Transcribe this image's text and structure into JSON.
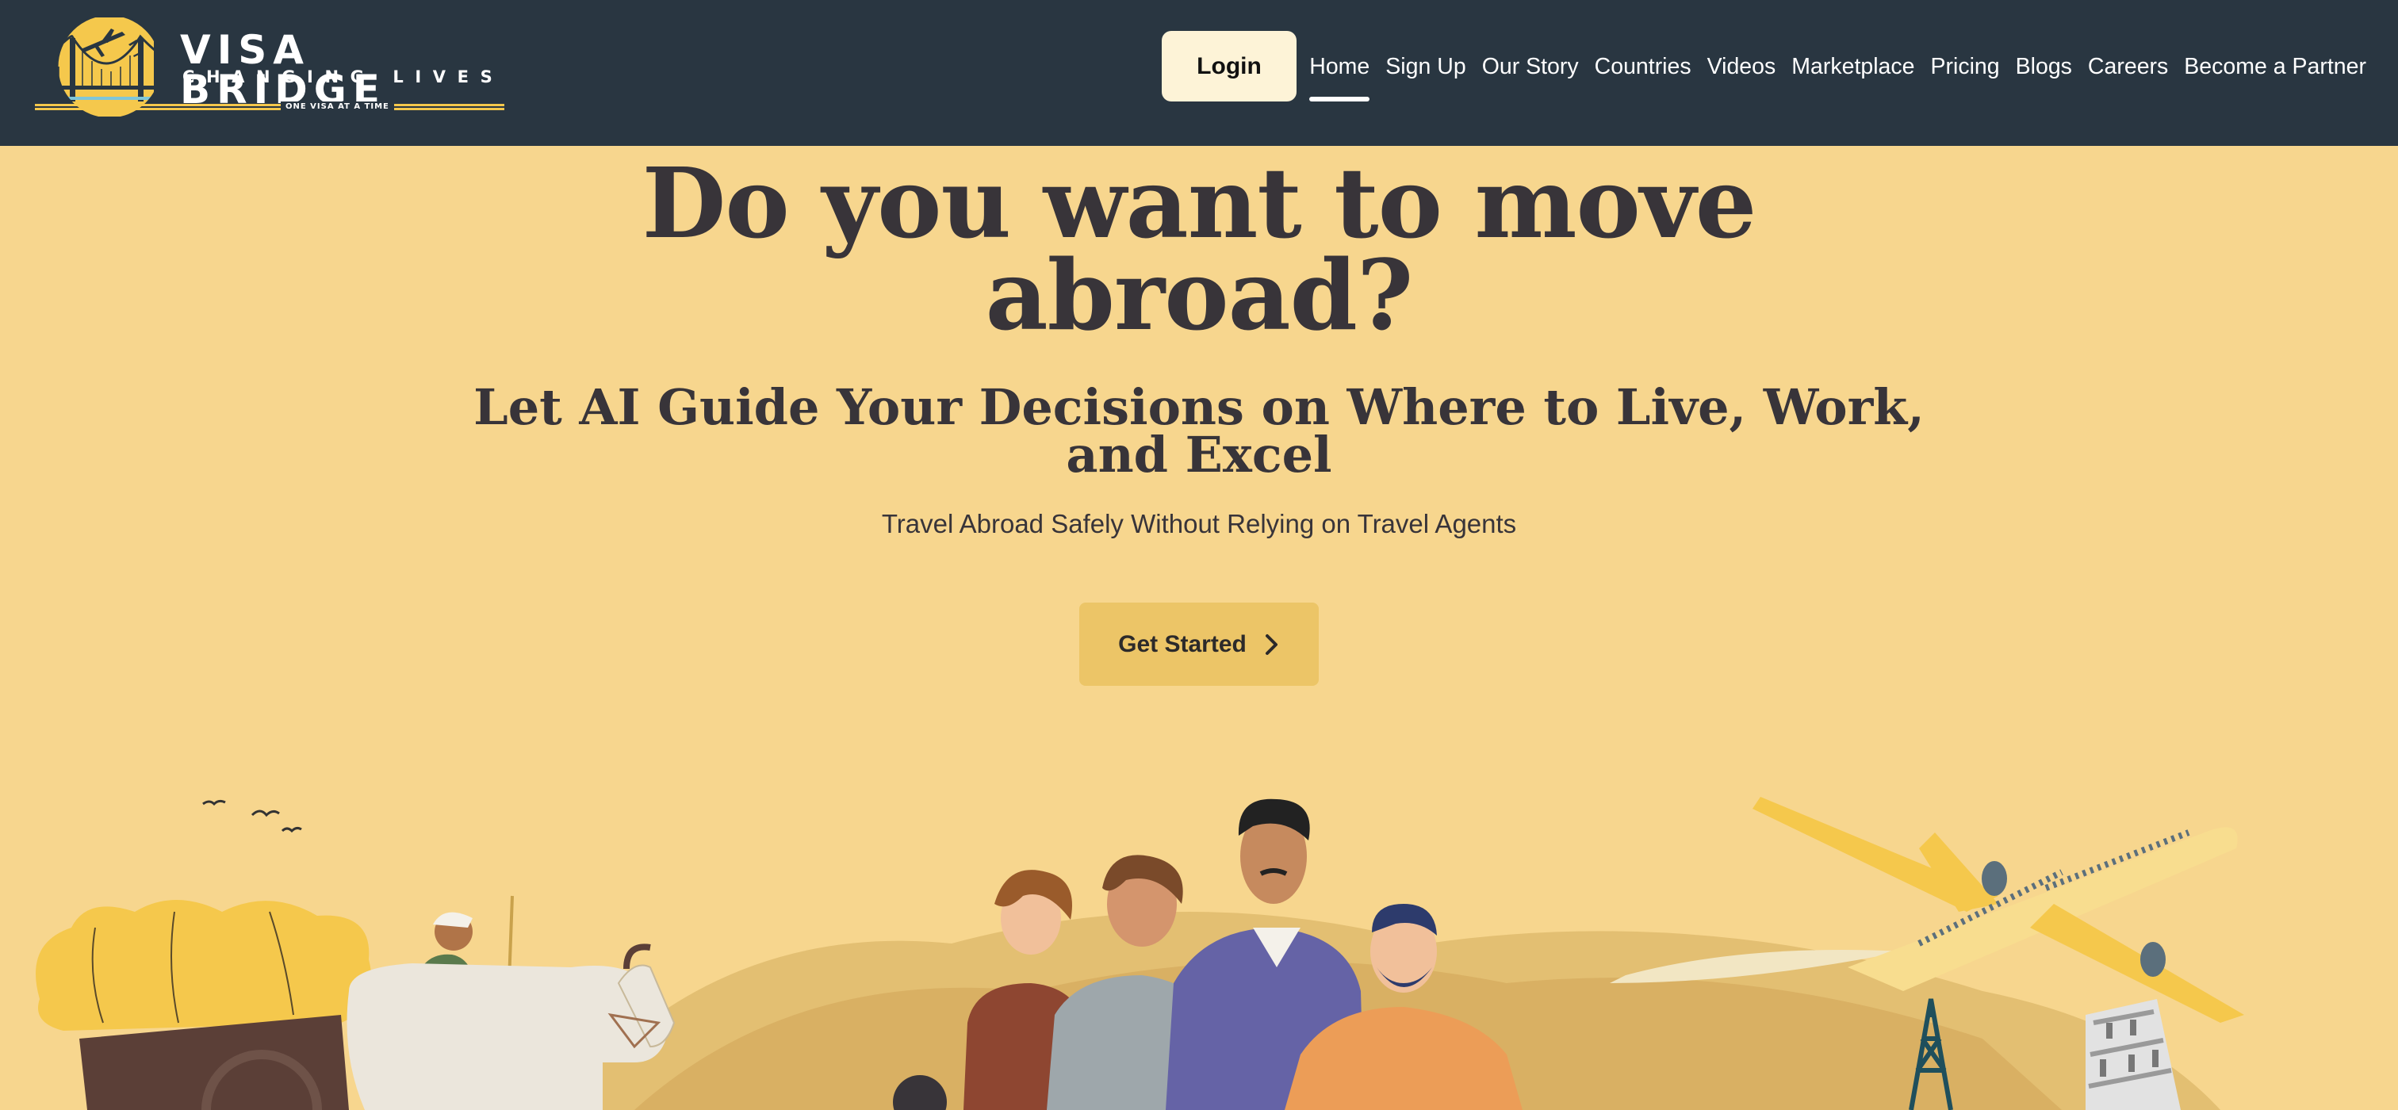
{
  "brand": {
    "name": "VISA BRIDGE",
    "subtitle": "CHANGING LIVES",
    "tagline": "ONE VISA AT A TIME"
  },
  "header": {
    "login_label": "Login",
    "nav": [
      {
        "label": "Home",
        "active": true
      },
      {
        "label": "Sign Up",
        "active": false
      },
      {
        "label": "Our Story",
        "active": false
      },
      {
        "label": "Countries",
        "active": false
      },
      {
        "label": "Videos",
        "active": false
      },
      {
        "label": "Marketplace",
        "active": false
      },
      {
        "label": "Pricing",
        "active": false
      },
      {
        "label": "Blogs",
        "active": false
      },
      {
        "label": "Careers",
        "active": false
      },
      {
        "label": "Become a Partner",
        "active": false
      }
    ]
  },
  "hero": {
    "title_line1": "Do you want to move",
    "title_line2": "abroad?",
    "subtitle": "Let AI Guide Your Decisions on Where to Live, Work, and Excel",
    "tagline": "Travel Abroad Safely Without Relying on Travel Agents",
    "cta_label": "Get Started",
    "cta_icon": "chevron-right-icon"
  },
  "illustration": {
    "elements": [
      "birds",
      "hay-cart",
      "farmer",
      "ox",
      "group-of-people",
      "airplane",
      "oil-derrick",
      "leaning-tower"
    ]
  },
  "colors": {
    "header_bg": "#293641",
    "page_bg": "#f7d68e",
    "login_bg": "#fdf3d7",
    "cta_bg": "#ecc567",
    "heading_text": "#383439"
  }
}
